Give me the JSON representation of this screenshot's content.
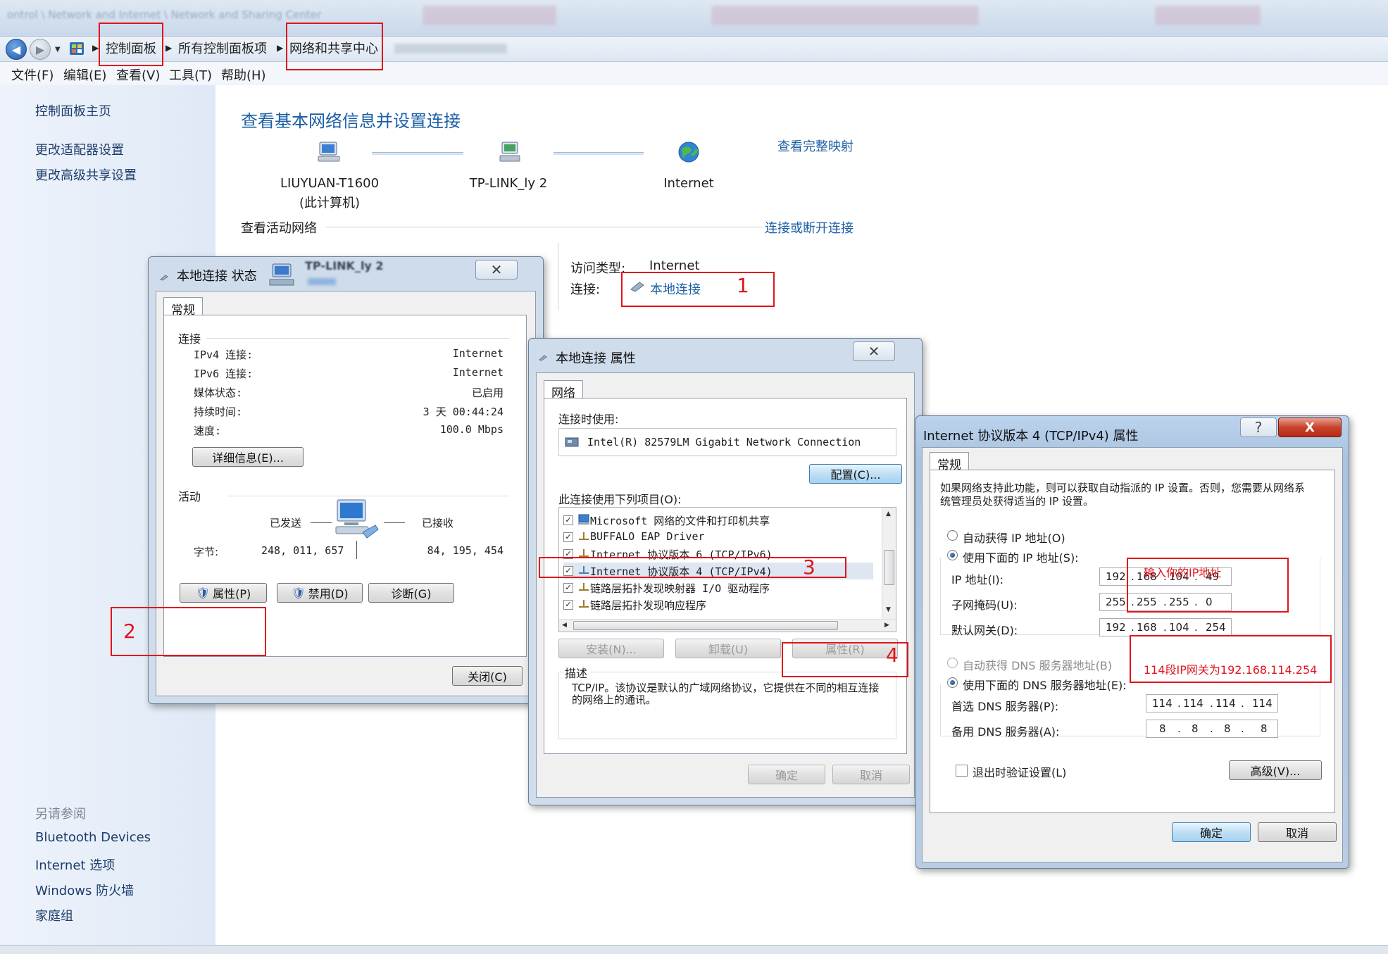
{
  "window": {
    "blurred_title": "ontrol \\ Network and Internet \\ Network and Sharing Center",
    "accent": "#1b5fa5",
    "annotation_color": "#e0141b"
  },
  "address_bar": {
    "breadcrumbs": [
      "控制面板",
      "所有控制面板项",
      "网络和共享中心"
    ],
    "icons": [
      "back-arrow",
      "forward-arrow",
      "control-panel-icon"
    ]
  },
  "menu": [
    "文件(F)",
    "编辑(E)",
    "查看(V)",
    "工具(T)",
    "帮助(H)"
  ],
  "left_pane": {
    "links": [
      "控制面板主页",
      "更改适配器设置",
      "更改高级共享设置"
    ],
    "see_also_title": "另请参阅",
    "see_also": [
      "Bluetooth Devices",
      "Internet 选项",
      "Windows 防火墙",
      "家庭组"
    ]
  },
  "main": {
    "title": "查看基本网络信息并设置连接",
    "view_full_map": "查看完整映射",
    "nodes": [
      {
        "name": "LIUYUAN-T1600",
        "sub": "(此计算机)",
        "icon": "computer-icon"
      },
      {
        "name": "TP-LINK_ly  2",
        "sub": "",
        "icon": "network-icon"
      },
      {
        "name": "Internet",
        "sub": "",
        "icon": "globe-icon"
      }
    ],
    "active_networks_label": "查看活动网络",
    "connect_disconnect": "连接或断开连接",
    "access_type_label": "访问类型:",
    "access_type_value": "Internet",
    "connection_label": "连接:",
    "connection_value": "本地连接"
  },
  "status_dialog": {
    "title": "本地连接 状态",
    "behind_text": "TP-LINK_ly  2",
    "tab": "常规",
    "connection_section": "连接",
    "rows": [
      {
        "label": "IPv4 连接:",
        "value": "Internet"
      },
      {
        "label": "IPv6 连接:",
        "value": "Internet"
      },
      {
        "label": "媒体状态:",
        "value": "已启用"
      },
      {
        "label": "持续时间:",
        "value": "3 天 00:44:24"
      },
      {
        "label": "速度:",
        "value": "100.0 Mbps"
      }
    ],
    "details_button": "详细信息(E)...",
    "activity_section": "活动",
    "sent_label": "已发送",
    "received_label": "已接收",
    "bytes_label": "字节:",
    "bytes_sent": "248, 011, 657",
    "bytes_received": "84, 195, 454",
    "properties_button": "属性(P)",
    "disable_button": "禁用(D)",
    "diagnose_button": "诊断(G)",
    "close_button": "关闭(C)"
  },
  "properties_dialog": {
    "title": "本地连接 属性",
    "tab": "网络",
    "connect_using_label": "连接时使用:",
    "adapter": "Intel(R) 82579LM Gigabit Network Connection",
    "configure_button": "配置(C)...",
    "items_label": "此连接使用下列项目(O):",
    "items": [
      {
        "text": "Microsoft 网络的文件和打印机共享",
        "checked": true
      },
      {
        "text": "BUFFALO EAP Driver",
        "checked": true
      },
      {
        "text": "Internet 协议版本 6 (TCP/IPv6)",
        "checked": true
      },
      {
        "text": "Internet 协议版本 4 (TCP/IPv4)",
        "checked": true
      },
      {
        "text": "链路层拓扑发现映射器 I/O 驱动程序",
        "checked": true
      },
      {
        "text": "链路层拓扑发现响应程序",
        "checked": true
      }
    ],
    "install_button": "安装(N)...",
    "uninstall_button": "卸载(U)",
    "properties_button": "属性(R)",
    "description_label": "描述",
    "description": "TCP/IP。该协议是默认的广域网络协议，它提供在不同的相互连接的网络上的通讯。",
    "ok_button": "确定",
    "cancel_button": "取消"
  },
  "ipv4_dialog": {
    "title": "Internet 协议版本 4 (TCP/IPv4) 属性",
    "help_button": "?",
    "close_button": "X",
    "tab": "常规",
    "intro": "如果网络支持此功能，则可以获取自动指派的 IP 设置。否则，您需要从网络系统管理员处获得适当的 IP 设置。",
    "auto_ip_label": "自动获得 IP 地址(O)",
    "manual_ip_label": "使用下面的 IP 地址(S):",
    "ip_label": "IP 地址(I):",
    "ip": [
      "192",
      "168",
      "104",
      "49"
    ],
    "mask_label": "子网掩码(U):",
    "mask": [
      "255",
      "255",
      "255",
      "0"
    ],
    "gateway_label": "默认网关(D):",
    "gateway": [
      "192",
      "168",
      "104",
      "254"
    ],
    "auto_dns_label": "自动获得 DNS 服务器地址(B)",
    "manual_dns_label": "使用下面的 DNS 服务器地址(E):",
    "dns1_label": "首选 DNS 服务器(P):",
    "dns1": [
      "114",
      "114",
      "114",
      "114"
    ],
    "dns2_label": "备用 DNS 服务器(A):",
    "dns2": [
      "8",
      "8",
      "8",
      "8"
    ],
    "validate_label": "退出时验证设置(L)",
    "advanced_button": "高级(V)...",
    "ok_button": "确定",
    "cancel_button": "取消"
  },
  "annotations": {
    "step1": "1",
    "step2": "2",
    "step3": "3",
    "step4": "4",
    "ip_hint": "输入你的IP地址",
    "gateway_hint": "114段IP网关为192.168.114.254"
  }
}
